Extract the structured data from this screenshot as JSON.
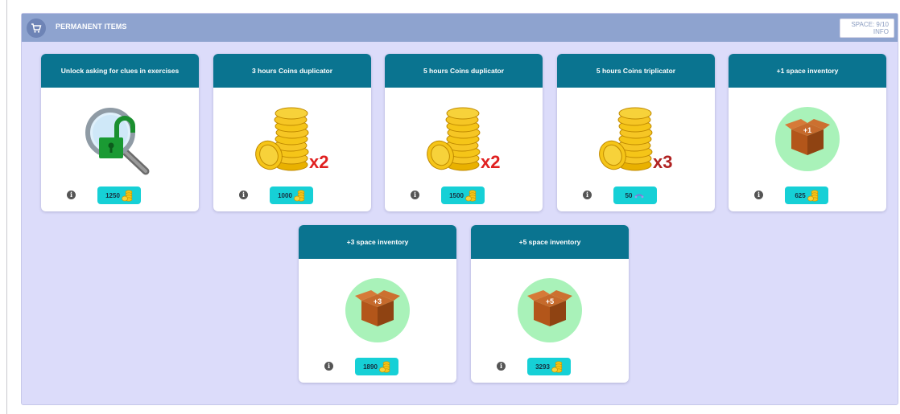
{
  "header": {
    "title": "PERMANENT ITEMS",
    "space_line1": "SPACE: 9/10",
    "space_line2": "INFO",
    "cart_icon": "shopping-cart-icon"
  },
  "items": [
    {
      "title": "Unlock asking for clues in exercises",
      "price": "1250",
      "currency": "coins",
      "image": "magnifier-unlock-icon"
    },
    {
      "title": "3 hours Coins duplicator",
      "price": "1000",
      "currency": "coins",
      "image": "coin-stack-icon",
      "multiplier": "x2"
    },
    {
      "title": "5 hours Coins duplicator",
      "price": "1500",
      "currency": "coins",
      "image": "coin-stack-icon",
      "multiplier": "x2"
    },
    {
      "title": "5 hours Coins triplicator",
      "price": "50",
      "currency": "gems",
      "image": "coin-stack-icon",
      "multiplier": "x3"
    },
    {
      "title": "+1 space inventory",
      "price": "625",
      "currency": "coins",
      "image": "box-icon",
      "box_label": "+1"
    },
    {
      "title": "+3 space inventory",
      "price": "1890",
      "currency": "coins",
      "image": "box-icon",
      "box_label": "+3"
    },
    {
      "title": "+5 space inventory",
      "price": "3293",
      "currency": "coins",
      "image": "box-icon",
      "box_label": "+5"
    }
  ],
  "colors": {
    "panel_bg": "#dcdcfa",
    "header_bg": "#8ea3cf",
    "card_header": "#0a7490",
    "price_pill": "#16d0d6",
    "multiplier_red": "#e02020"
  }
}
